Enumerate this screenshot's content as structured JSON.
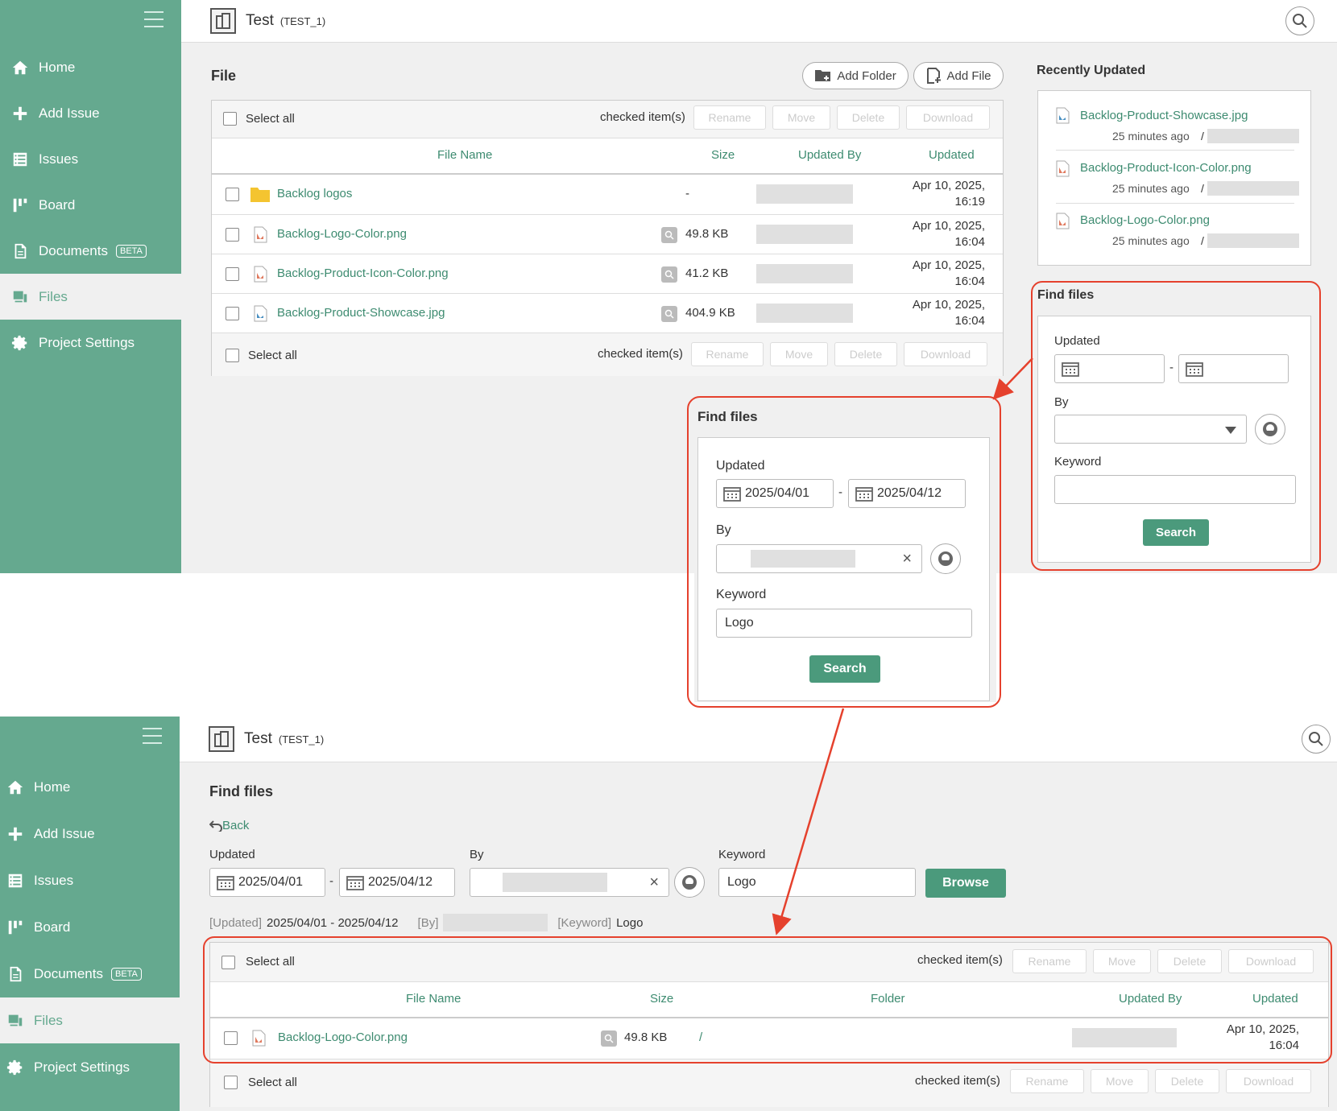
{
  "sidebar": {
    "items": [
      {
        "label": "Home",
        "icon": "home-icon"
      },
      {
        "label": "Add Issue",
        "icon": "plus-icon"
      },
      {
        "label": "Issues",
        "icon": "list-icon"
      },
      {
        "label": "Board",
        "icon": "board-icon"
      },
      {
        "label": "Documents",
        "icon": "document-icon",
        "badge": "BETA"
      },
      {
        "label": "Files",
        "icon": "files-icon"
      },
      {
        "label": "Project Settings",
        "icon": "gear-icon"
      }
    ]
  },
  "header": {
    "project_name": "Test",
    "project_key": "(TEST_1)"
  },
  "top": {
    "title": "File",
    "add_folder": "Add Folder",
    "add_file": "Add File",
    "select_all": "Select all",
    "checked_items": "checked item(s)",
    "actions": [
      "Rename",
      "Move",
      "Delete",
      "Download"
    ],
    "columns": [
      "File Name",
      "Size",
      "Updated By",
      "Updated"
    ],
    "rows": [
      {
        "name": "Backlog logos",
        "type": "folder",
        "size": "-",
        "updated": [
          "Apr 10, 2025,",
          "16:19"
        ]
      },
      {
        "name": "Backlog-Logo-Color.png",
        "type": "png",
        "size": "49.8 KB",
        "updated": [
          "Apr 10, 2025,",
          "16:04"
        ]
      },
      {
        "name": "Backlog-Product-Icon-Color.png",
        "type": "png",
        "size": "41.2 KB",
        "updated": [
          "Apr 10, 2025,",
          "16:04"
        ]
      },
      {
        "name": "Backlog-Product-Showcase.jpg",
        "type": "jpg",
        "size": "404.9 KB",
        "updated": [
          "Apr 10, 2025,",
          "16:04"
        ]
      }
    ],
    "recently_updated": {
      "title": "Recently Updated",
      "items": [
        {
          "name": "Backlog-Product-Showcase.jpg",
          "type": "jpg",
          "ago": "25 minutes ago",
          "sep": "/"
        },
        {
          "name": "Backlog-Product-Icon-Color.png",
          "type": "png",
          "ago": "25 minutes ago",
          "sep": "/"
        },
        {
          "name": "Backlog-Logo-Color.png",
          "type": "png",
          "ago": "25 minutes ago",
          "sep": "/"
        }
      ]
    },
    "find_files_empty": {
      "title": "Find files",
      "updated_label": "Updated",
      "dash": "-",
      "by_label": "By",
      "keyword_label": "Keyword",
      "search": "Search"
    }
  },
  "zoomed_find": {
    "title": "Find files",
    "updated_label": "Updated",
    "from": "2025/04/01",
    "to": "2025/04/12",
    "dash": "-",
    "by_label": "By",
    "clear": "×",
    "keyword_label": "Keyword",
    "keyword": "Logo",
    "search": "Search"
  },
  "bottom": {
    "title": "Find files",
    "back": "Back",
    "updated_label": "Updated",
    "from": "2025/04/01",
    "to": "2025/04/12",
    "dash": "-",
    "by_label": "By",
    "clear": "×",
    "keyword_label": "Keyword",
    "keyword": "Logo",
    "browse": "Browse",
    "summary": {
      "updated_tag": "[Updated]",
      "updated_value": "2025/04/01 - 2025/04/12",
      "by_tag": "[By]",
      "keyword_tag": "[Keyword]",
      "keyword_value": "Logo"
    },
    "select_all": "Select all",
    "checked_items": "checked item(s)",
    "actions": [
      "Rename",
      "Move",
      "Delete",
      "Download"
    ],
    "columns": [
      "File Name",
      "Size",
      "Folder",
      "Updated By",
      "Updated"
    ],
    "rows": [
      {
        "name": "Backlog-Logo-Color.png",
        "type": "png",
        "size": "49.8 KB",
        "folder": "/",
        "updated": [
          "Apr 10, 2025,",
          "16:04"
        ]
      }
    ]
  },
  "colors": {
    "sidebar": "#65a98f",
    "accent": "#3d8b70",
    "highlight": "#e5412d",
    "button": "#4b9a7c"
  }
}
